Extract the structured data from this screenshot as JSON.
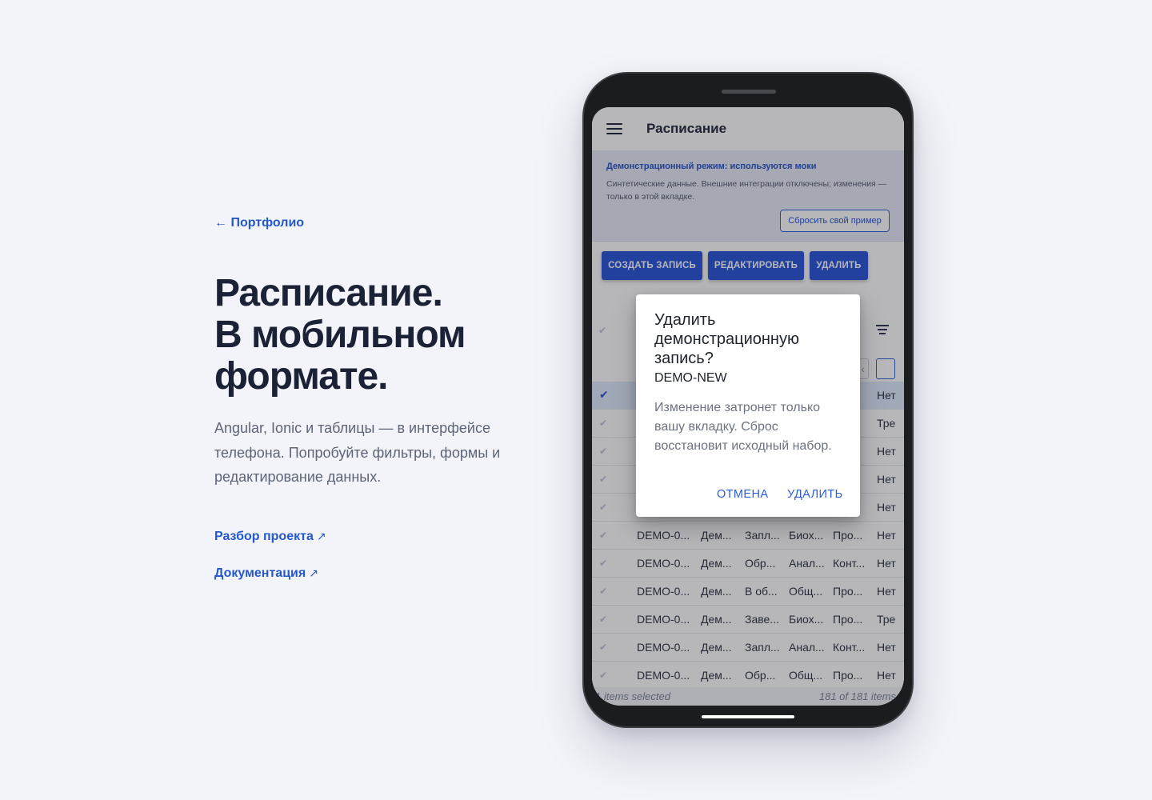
{
  "left": {
    "back_link": "← Портфолио",
    "title_lines": [
      "Расписание.",
      "В мобильном",
      "формате."
    ],
    "description": "Angular, Ionic и таблицы — в интерфейсе телефона. Попробуйте фильтры, формы и редактирование данных.",
    "link_breakdown": "Разбор проекта",
    "link_docs": "Документация",
    "link_arrow": "↗"
  },
  "app": {
    "title": "Расписание",
    "banner": {
      "title": "Демонстрационный режим: используются моки",
      "text": "Синтетические данные. Внешние интеграции отключены; изменения — только в этой вкладке.",
      "reset_button": "Сбросить свой пример"
    },
    "actions": {
      "create": "СОЗДАТЬ ЗАПИСЬ",
      "edit": "РЕДАКТИРОВАТЬ",
      "delete": "УДАЛИТЬ"
    },
    "table": {
      "rows": [
        {
          "c1": "",
          "c2": "",
          "c3": "",
          "c4": "",
          "c5": "",
          "c6": "Нет",
          "selected": true
        },
        {
          "c1": "",
          "c2": "",
          "c3": "",
          "c4": "",
          "c5": "",
          "c6": "Тре"
        },
        {
          "c1": "",
          "c2": "",
          "c3": "",
          "c4": "",
          "c5": "",
          "c6": "Нет"
        },
        {
          "c1": "",
          "c2": "",
          "c3": "",
          "c4": "",
          "c5": "",
          "c6": "Нет"
        },
        {
          "c1": "",
          "c2": "",
          "c3": "",
          "c4": "",
          "c5": "",
          "c6": "Нет"
        },
        {
          "c1": "DEMO-0...",
          "c2": "Дем...",
          "c3": "Запл...",
          "c4": "Биох...",
          "c5": "Про...",
          "c6": "Нет"
        },
        {
          "c1": "DEMO-0...",
          "c2": "Дем...",
          "c3": "Обр...",
          "c4": "Анал...",
          "c5": "Конт...",
          "c6": "Нет"
        },
        {
          "c1": "DEMO-0...",
          "c2": "Дем...",
          "c3": "В об...",
          "c4": "Общ...",
          "c5": "Про...",
          "c6": "Нет"
        },
        {
          "c1": "DEMO-0...",
          "c2": "Дем...",
          "c3": "Заве...",
          "c4": "Биох...",
          "c5": "Про...",
          "c6": "Тре"
        },
        {
          "c1": "DEMO-0...",
          "c2": "Дем...",
          "c3": "Запл...",
          "c4": "Анал...",
          "c5": "Конт...",
          "c6": "Нет"
        },
        {
          "c1": "DEMO-0...",
          "c2": "Дем...",
          "c3": "Обр...",
          "c4": "Общ...",
          "c5": "Про...",
          "c6": "Нет"
        }
      ],
      "footer_left": "1 items selected",
      "footer_right": "181 of 181 items"
    },
    "dialog": {
      "title": "Удалить демонстрационную запись?",
      "subtitle": "DEMO-NEW",
      "body": "Изменение затронет только вашу вкладку. Сброс восстановит исходный набор.",
      "cancel": "ОТМЕНА",
      "confirm": "УДАЛИТЬ"
    }
  },
  "colors": {
    "accent": "#2450d6",
    "link": "#2558c9",
    "page_bg": "#f3f4f9"
  },
  "icons": {
    "menu": "hamburger-menu-icon",
    "check": "checkmark-icon",
    "filter": "filter-lines-icon"
  }
}
